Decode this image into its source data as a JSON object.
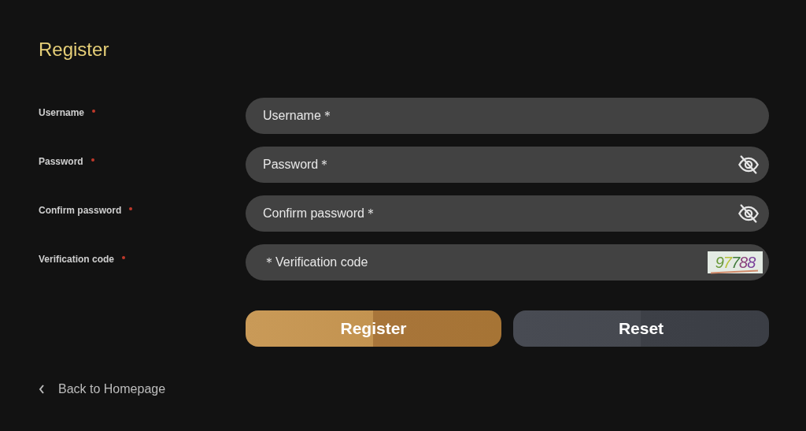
{
  "title": "Register",
  "fields": [
    {
      "label": "Username",
      "required": true,
      "kind": "plain",
      "placeholder": "Username＊"
    },
    {
      "label": "Password",
      "required": true,
      "kind": "password",
      "placeholder": "Password＊"
    },
    {
      "label": "Confirm password",
      "required": true,
      "kind": "password",
      "placeholder": "Confirm password＊"
    },
    {
      "label": "Verification code",
      "required": true,
      "kind": "captcha",
      "placeholder": "＊Verification code",
      "captcha": "97788"
    }
  ],
  "buttons": [
    {
      "label": "Register",
      "kind": "primary"
    },
    {
      "label": "Reset",
      "kind": "secondary"
    }
  ],
  "back_link": "Back to Homepage"
}
